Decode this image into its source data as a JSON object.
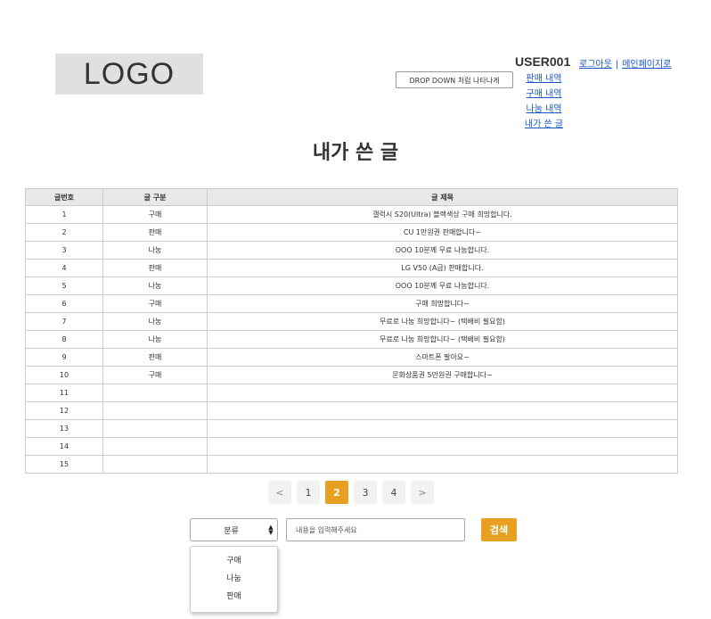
{
  "header": {
    "logo_text": "LOGO",
    "user_id": "USER001",
    "logout_link": "로그아웃",
    "separator": "|",
    "main_page_link": "메인페이지로",
    "dropdown_trigger": "DROP DOWN 처럼 나타나게",
    "dropdown_menu": [
      {
        "label": "판매 내역"
      },
      {
        "label": "구매 내역"
      },
      {
        "label": "나눔 내역"
      },
      {
        "label": "내가 쓴 글"
      }
    ]
  },
  "page_title": "내가 쓴 글",
  "table": {
    "columns": [
      "글번호",
      "글 구분",
      "글 제목"
    ],
    "rows": [
      {
        "no": "1",
        "type": "구매",
        "title": "갤럭시 S20(Ultra) 블랙색상 구매 희망합니다."
      },
      {
        "no": "2",
        "type": "판매",
        "title": "CU 1만원권 판매합니다~"
      },
      {
        "no": "3",
        "type": "나눔",
        "title": "OOO 10분께 무료 나눔합니다."
      },
      {
        "no": "4",
        "type": "판매",
        "title": "LG V50 (A급) 판매합니다."
      },
      {
        "no": "5",
        "type": "나눔",
        "title": "OOO 10분께 무료 나눔합니다."
      },
      {
        "no": "6",
        "type": "구매",
        "title": "구매 희망합니다~"
      },
      {
        "no": "7",
        "type": "나눔",
        "title": "무료로 나눔 희망합니다~ (택배비 필요함)"
      },
      {
        "no": "8",
        "type": "나눔",
        "title": "무료로 나눔 희망합니다~ (택배비 필요함)"
      },
      {
        "no": "9",
        "type": "판매",
        "title": "스마트폰 팔아요~"
      },
      {
        "no": "10",
        "type": "구매",
        "title": "문화상품권 5만원권 구매합니다~"
      },
      {
        "no": "11",
        "type": "",
        "title": ""
      },
      {
        "no": "12",
        "type": "",
        "title": ""
      },
      {
        "no": "13",
        "type": "",
        "title": ""
      },
      {
        "no": "14",
        "type": "",
        "title": ""
      },
      {
        "no": "15",
        "type": "",
        "title": ""
      }
    ]
  },
  "pagination": {
    "prev": "<",
    "pages": [
      "1",
      "2",
      "3",
      "4"
    ],
    "current": "2",
    "next": ">"
  },
  "search": {
    "category_value": "분류",
    "input_placeholder": "내용을 입력해주세요",
    "button_label": "검색",
    "category_options": [
      "구매",
      "나눔",
      "판매"
    ]
  },
  "colors": {
    "accent": "#e8a020",
    "link": "#1a56c4",
    "header_bg": "#e8e8e8"
  }
}
